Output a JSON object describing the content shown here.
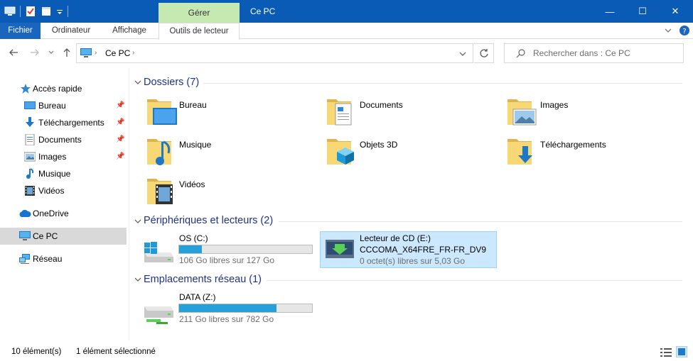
{
  "window": {
    "title": "Ce PC",
    "context_tab": "Gérer",
    "minimize": "—",
    "maximize": "☐",
    "close": "✕"
  },
  "ribbon": {
    "tabs": [
      "Fichier",
      "Ordinateur",
      "Affichage",
      "Outils de lecteur"
    ]
  },
  "address": {
    "path": "Ce PC",
    "search_placeholder": "Rechercher dans : Ce PC"
  },
  "sidebar": {
    "items": [
      {
        "label": "Accès rapide",
        "icon": "star-icon"
      },
      {
        "label": "Bureau",
        "icon": "desktop-icon",
        "pinned": true
      },
      {
        "label": "Téléchargements",
        "icon": "download-icon",
        "pinned": true
      },
      {
        "label": "Documents",
        "icon": "document-icon",
        "pinned": true
      },
      {
        "label": "Images",
        "icon": "pictures-icon",
        "pinned": true
      },
      {
        "label": "Musique",
        "icon": "music-icon"
      },
      {
        "label": "Vidéos",
        "icon": "video-icon"
      },
      {
        "label": "OneDrive",
        "icon": "cloud-icon"
      },
      {
        "label": "Ce PC",
        "icon": "computer-icon",
        "selected": true
      },
      {
        "label": "Réseau",
        "icon": "network-icon"
      }
    ]
  },
  "groups": {
    "folders": {
      "title": "Dossiers (7)",
      "items": [
        "Bureau",
        "Documents",
        "Images",
        "Musique",
        "Objets 3D",
        "Téléchargements",
        "Vidéos"
      ]
    },
    "devices": {
      "title": "Périphériques et lecteurs (2)",
      "os": {
        "name": "OS (C:)",
        "free": "106 Go libres sur 127 Go",
        "used_fraction": 0.17
      },
      "cd": {
        "name": "Lecteur de CD (E:)",
        "label": "CCCOMA_X64FRE_FR-FR_DV9",
        "free": "0 octet(s) libres sur 5,03 Go"
      }
    },
    "network": {
      "title": "Emplacements réseau (1)",
      "data": {
        "name": "DATA (Z:)",
        "free": "211 Go libres sur 782 Go",
        "used_fraction": 0.73
      }
    }
  },
  "status": {
    "count": "10 élément(s)",
    "selected": "1 élément sélectionné"
  },
  "colors": {
    "titlebar": "#0a5bb5",
    "context_tab": "#c5e9b1",
    "group_heading": "#1e3287",
    "bar_fill": "#26a0da",
    "selection": "#cce8ff"
  }
}
